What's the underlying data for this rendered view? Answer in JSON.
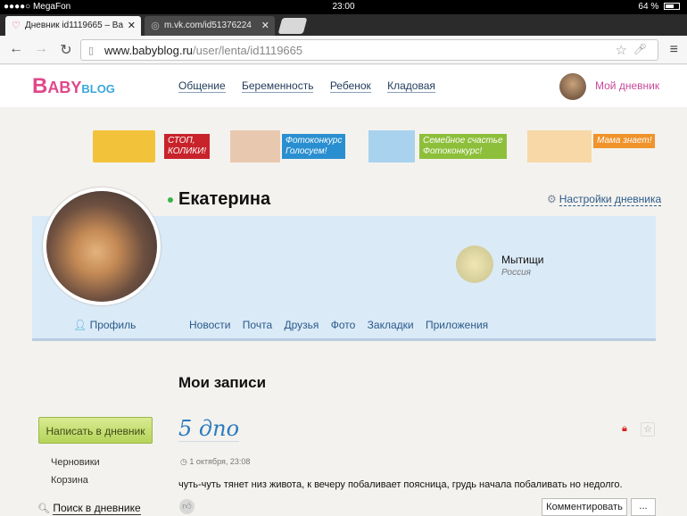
{
  "status_bar": {
    "carrier": "●●●●○ MegaFon",
    "time": "23:00",
    "battery": "64 %",
    "battery_level": 0.64
  },
  "browser": {
    "tabs": [
      {
        "title": "Дневник id1119665 – Ba",
        "close": "✕",
        "favicon": "babyblog-favicon-icon"
      },
      {
        "title": "m.vk.com/id51376224",
        "close": "✕",
        "favicon": "globe-icon"
      }
    ],
    "url_domain": "www.babyblog.ru",
    "url_path": "/user/lenta/id1119665"
  },
  "site": {
    "logo_b": "B",
    "logo_aby": "ABY",
    "logo_blog": "BLOG",
    "nav": [
      "Общение",
      "Беременность",
      "Ребенок",
      "Кладовая"
    ],
    "my_diary": "Мой дневник"
  },
  "banners": [
    {
      "label": "СТОП,\nКОЛИКИ!",
      "color": "#c8232b",
      "img_color": "#f2c33a"
    },
    {
      "label": "Фотоконкурс\nГолосуем!",
      "color": "#2a8fd0",
      "img_color": "#e8c9b0"
    },
    {
      "label": "Семейное счастье\nФотоконкурс!",
      "color": "#8dbf3a",
      "img_color": "#a8d2ee"
    },
    {
      "label": "Мама знает!",
      "color": "#f0932b",
      "img_color": "#f7d8a6"
    }
  ],
  "profile": {
    "name": "Екатерина",
    "settings": "Настройки дневника",
    "city": "Мытищи",
    "country": "Россия",
    "profile_link": "Профиль",
    "subnav": [
      "Новости",
      "Почта",
      "Друзья",
      "Фото",
      "Закладки",
      "Приложения"
    ]
  },
  "sidebar": {
    "write_button": "Написать в дневник",
    "drafts": "Черновики",
    "trash": "Корзина",
    "search": "Поиск в дневнике"
  },
  "main": {
    "section_title": "Мои записи",
    "post": {
      "title": "5 дпо",
      "date": "1 октября, 23:08",
      "text": "чуть-чуть тянет низ живота, к вечеру побаливает поясница, грудь начала побаливать но недолго.",
      "comment_button": "Комментировать",
      "more_button": "..."
    }
  }
}
